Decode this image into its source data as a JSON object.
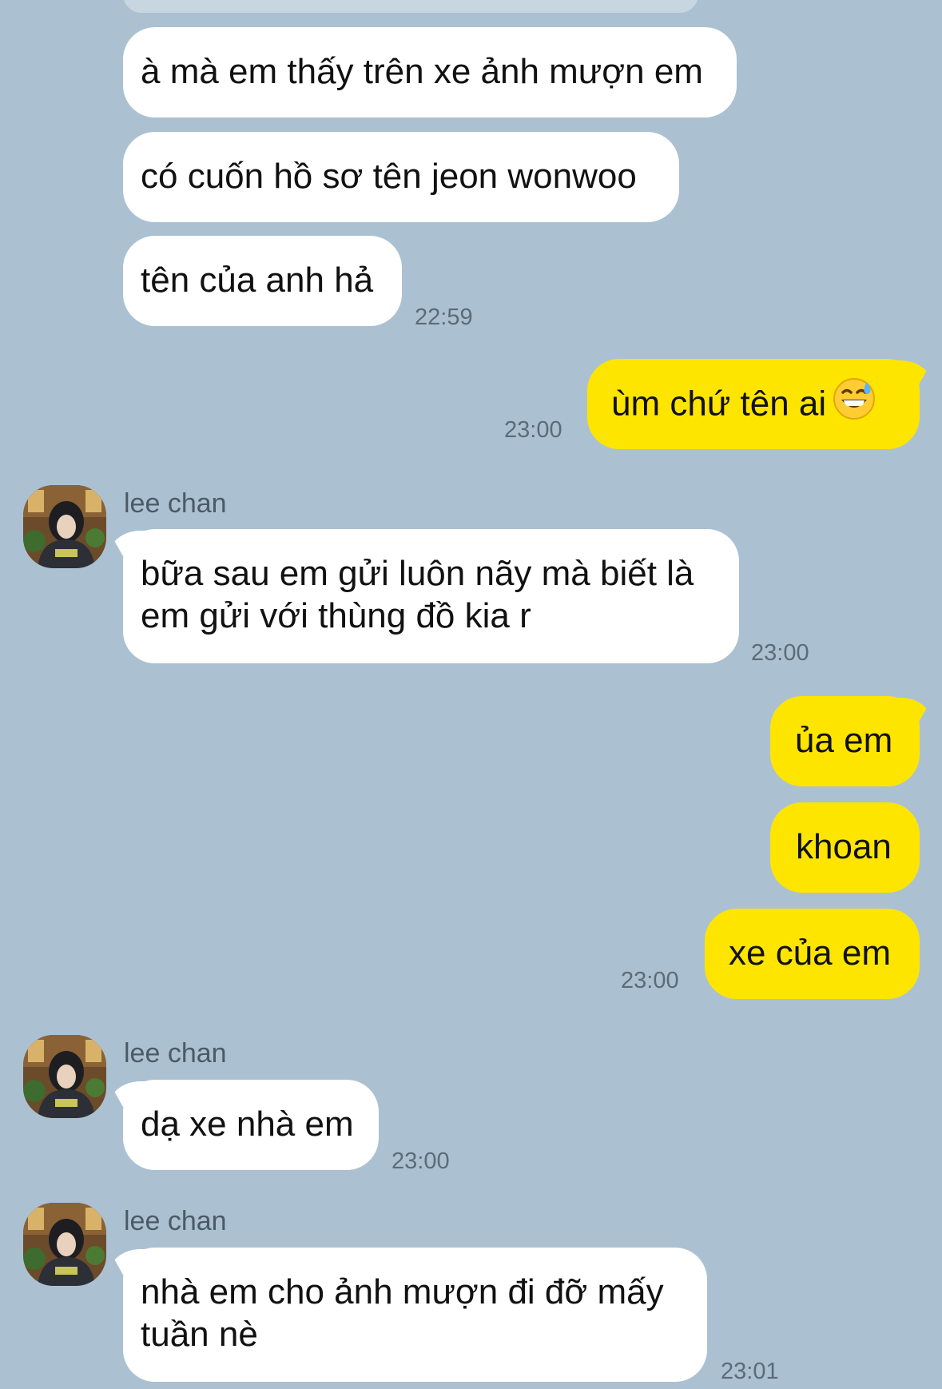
{
  "messages": [
    {
      "text": "à mà em thấy trên xe ảnh mượn em"
    },
    {
      "text": "có cuốn hồ sơ tên jeon wonwoo"
    },
    {
      "text": "tên của anh hả",
      "time": "22:59"
    },
    {
      "text": "ùm chứ tên ai",
      "emoji": "grinning-face-with-sweat",
      "time": "23:00"
    },
    {
      "sender": "lee chan",
      "text": "bữa sau em gửi luôn nãy mà biết là em gửi với thùng đồ kia r",
      "time": "23:00"
    },
    {
      "text": "ủa em"
    },
    {
      "text": "khoan"
    },
    {
      "text": "xe của em",
      "time": "23:00"
    },
    {
      "sender": "lee chan",
      "text": "dạ xe nhà em",
      "time": "23:00"
    },
    {
      "sender": "lee chan",
      "text": "nhà em cho ảnh mượn đi đỡ mấy tuần nè",
      "time": "23:01"
    }
  ]
}
